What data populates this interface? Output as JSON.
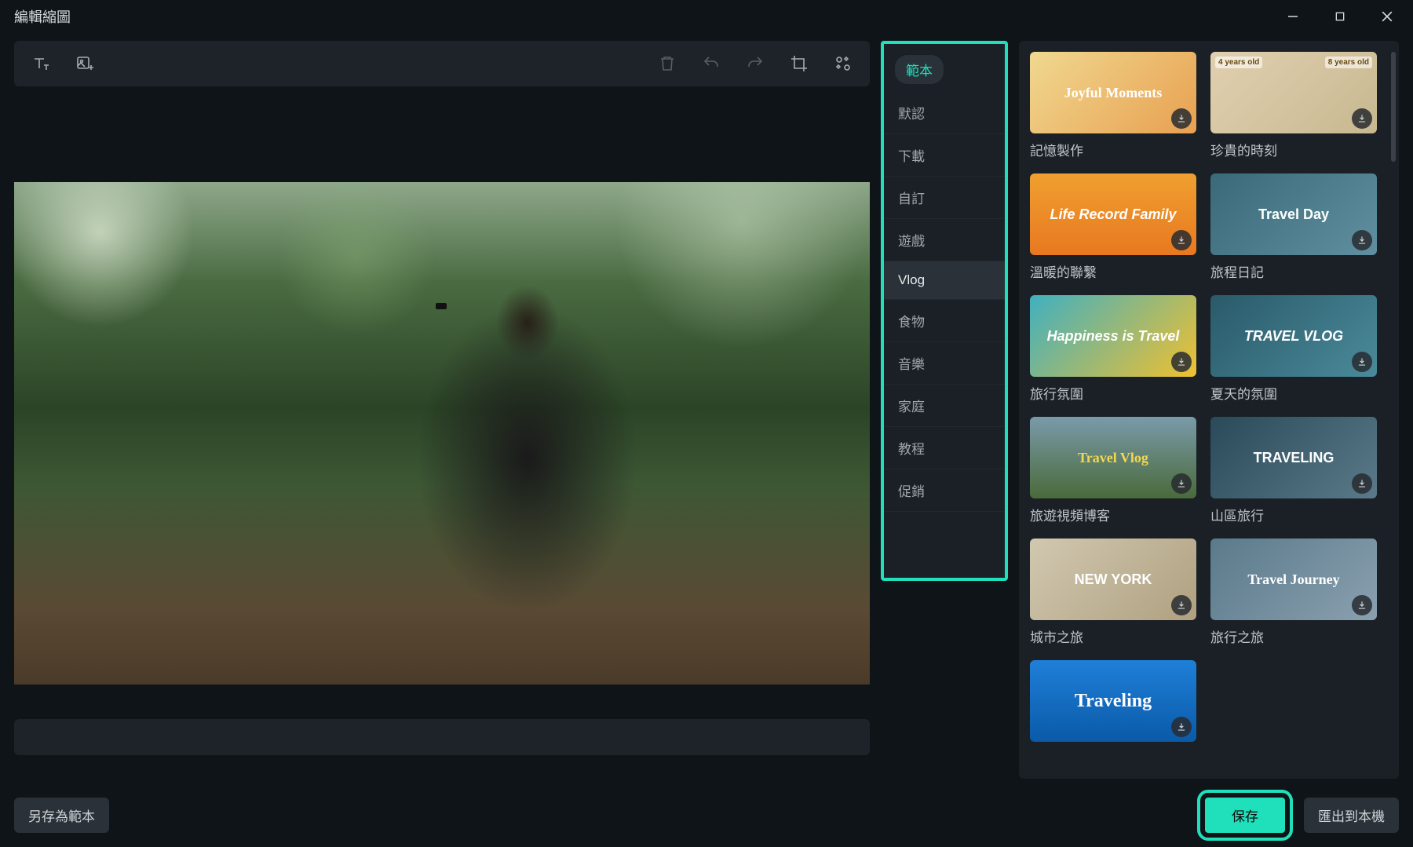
{
  "window_title": "編輯縮圖",
  "toolbar": {
    "text_tool": "add-text",
    "image_tool": "add-image",
    "delete_tool": "delete",
    "undo_tool": "undo",
    "redo_tool": "redo",
    "crop_tool": "crop",
    "ai_tool": "ai-enhance"
  },
  "category_panel": {
    "tab_label": "範本",
    "items": [
      {
        "label": "默認",
        "active": false
      },
      {
        "label": "下載",
        "active": false
      },
      {
        "label": "自訂",
        "active": false
      },
      {
        "label": "遊戲",
        "active": false
      },
      {
        "label": "Vlog",
        "active": true
      },
      {
        "label": "食物",
        "active": false
      },
      {
        "label": "音樂",
        "active": false
      },
      {
        "label": "家庭",
        "active": false
      },
      {
        "label": "教程",
        "active": false
      },
      {
        "label": "促銷",
        "active": false
      }
    ]
  },
  "templates": [
    {
      "label": "記憶製作",
      "thumb_text": "Joyful Moments",
      "theme": "th1",
      "badges": []
    },
    {
      "label": "珍貴的時刻",
      "thumb_text": "",
      "theme": "th2",
      "badges": [
        "4 years old",
        "8 years old"
      ]
    },
    {
      "label": "溫暖的聯繫",
      "thumb_text": "Life Record Family",
      "theme": "th3",
      "badges": []
    },
    {
      "label": "旅程日記",
      "thumb_text": "Travel Day",
      "theme": "th4",
      "badges": []
    },
    {
      "label": "旅行氛圍",
      "thumb_text": "Happiness is Travel",
      "theme": "th5",
      "badges": []
    },
    {
      "label": "夏天的氛圍",
      "thumb_text": "TRAVEL VLOG",
      "theme": "th6",
      "badges": []
    },
    {
      "label": "旅遊視頻博客",
      "thumb_text": "Travel Vlog",
      "theme": "th7",
      "badges": []
    },
    {
      "label": "山區旅行",
      "thumb_text": "TRAVELING",
      "theme": "th8",
      "badges": []
    },
    {
      "label": "城市之旅",
      "thumb_text": "NEW YORK",
      "theme": "th9",
      "badges": []
    },
    {
      "label": "旅行之旅",
      "thumb_text": "Travel Journey",
      "theme": "th10",
      "badges": []
    },
    {
      "label": "",
      "thumb_text": "Traveling",
      "theme": "th11",
      "badges": []
    }
  ],
  "footer": {
    "save_as_template": "另存為範本",
    "save": "保存",
    "export_local": "匯出到本機"
  }
}
